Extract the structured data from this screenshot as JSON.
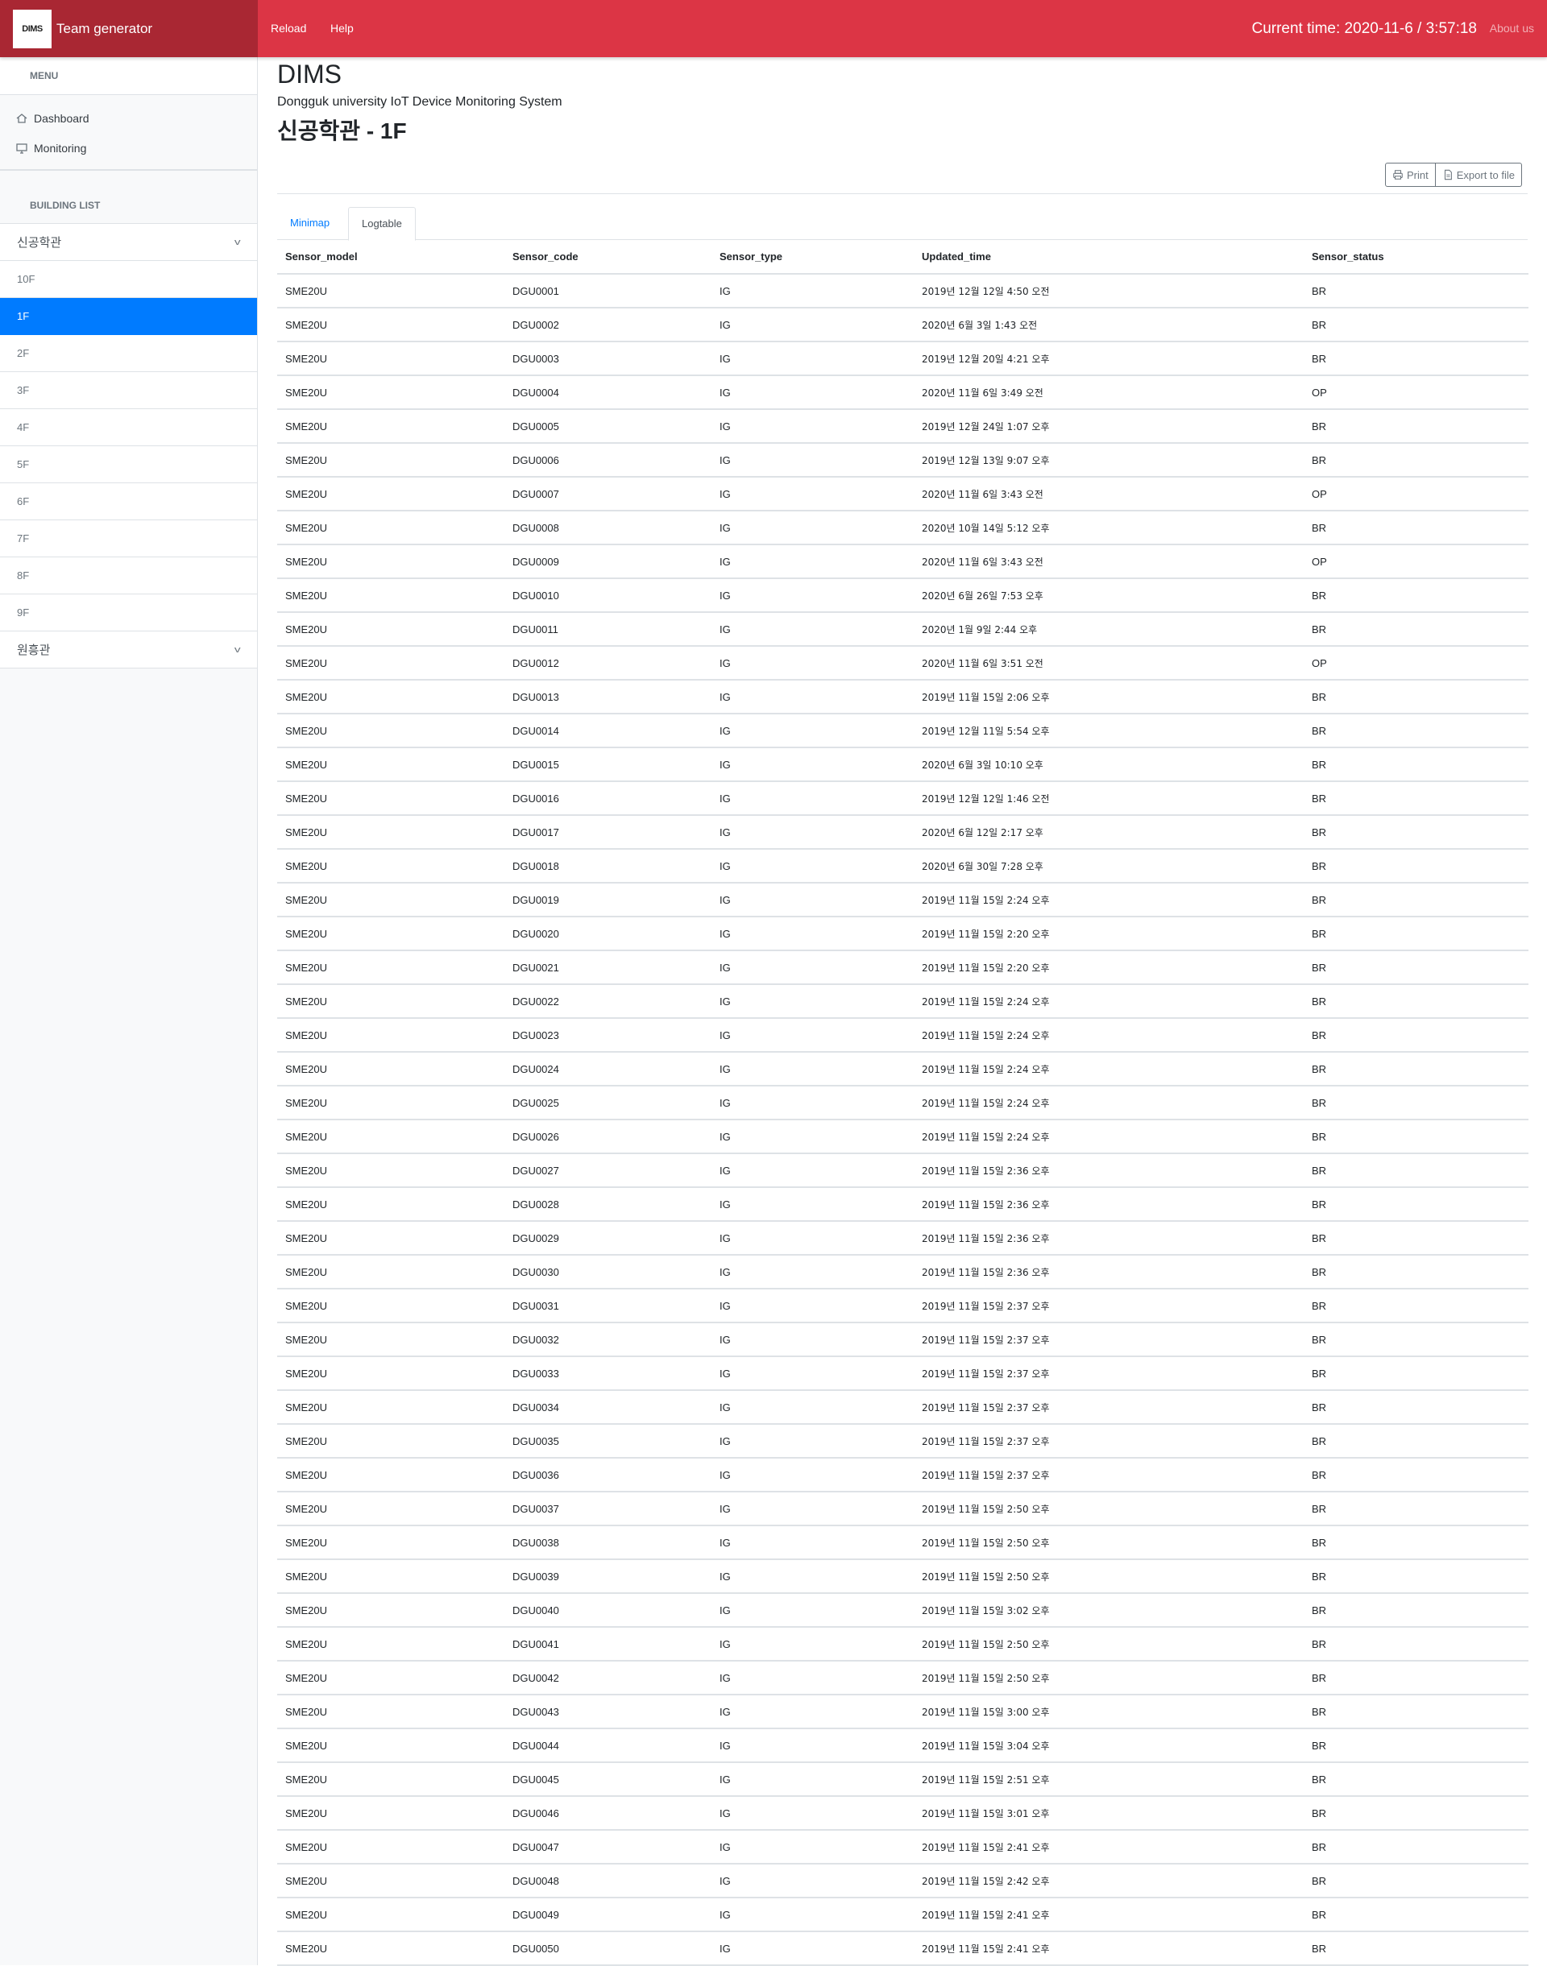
{
  "navbar": {
    "brand_logo": "DIMS",
    "brand_name": "Team generator",
    "links": [
      "Reload",
      "Help"
    ],
    "current_time": "Current time: 2020-11-6 / 3:57:18",
    "about": "About us",
    "color": "#dc3545",
    "brand_color": "#a92733"
  },
  "sidebar": {
    "menu_heading": "MENU",
    "menu_items": [
      {
        "label": "Dashboard",
        "icon": "home-icon"
      },
      {
        "label": "Monitoring",
        "icon": "monitor-icon"
      }
    ],
    "building_list_heading": "BUILDING LIST",
    "buildings": [
      {
        "name": "신공학관",
        "floors": [
          "10F",
          "1F",
          "2F",
          "3F",
          "4F",
          "5F",
          "6F",
          "7F",
          "8F",
          "9F"
        ],
        "active_floor": "1F"
      },
      {
        "name": "원흥관",
        "floors": []
      }
    ],
    "active_color": "#007bff"
  },
  "main": {
    "title": "DIMS",
    "subtitle": "Dongguk university IoT Device Monitoring System",
    "floor_title": "신공학관 - 1F",
    "buttons": {
      "print": "Print",
      "export": "Export to file"
    },
    "tabs": [
      {
        "label": "Minimap",
        "active": false
      },
      {
        "label": "Logtable",
        "active": true
      }
    ]
  },
  "table": {
    "columns": [
      "Sensor_model",
      "Sensor_code",
      "Sensor_type",
      "Updated_time",
      "Sensor_status"
    ],
    "rows": [
      [
        "SME20U",
        "DGU0001",
        "IG",
        "2019년 12월 12일 4:50 오전",
        "BR"
      ],
      [
        "SME20U",
        "DGU0002",
        "IG",
        "2020년 6월 3일 1:43 오전",
        "BR"
      ],
      [
        "SME20U",
        "DGU0003",
        "IG",
        "2019년 12월 20일 4:21 오후",
        "BR"
      ],
      [
        "SME20U",
        "DGU0004",
        "IG",
        "2020년 11월 6일 3:49 오전",
        "OP"
      ],
      [
        "SME20U",
        "DGU0005",
        "IG",
        "2019년 12월 24일 1:07 오후",
        "BR"
      ],
      [
        "SME20U",
        "DGU0006",
        "IG",
        "2019년 12월 13일 9:07 오후",
        "BR"
      ],
      [
        "SME20U",
        "DGU0007",
        "IG",
        "2020년 11월 6일 3:43 오전",
        "OP"
      ],
      [
        "SME20U",
        "DGU0008",
        "IG",
        "2020년 10월 14일 5:12 오후",
        "BR"
      ],
      [
        "SME20U",
        "DGU0009",
        "IG",
        "2020년 11월 6일 3:43 오전",
        "OP"
      ],
      [
        "SME20U",
        "DGU0010",
        "IG",
        "2020년 6월 26일 7:53 오후",
        "BR"
      ],
      [
        "SME20U",
        "DGU0011",
        "IG",
        "2020년 1월 9일 2:44 오후",
        "BR"
      ],
      [
        "SME20U",
        "DGU0012",
        "IG",
        "2020년 11월 6일 3:51 오전",
        "OP"
      ],
      [
        "SME20U",
        "DGU0013",
        "IG",
        "2019년 11월 15일 2:06 오후",
        "BR"
      ],
      [
        "SME20U",
        "DGU0014",
        "IG",
        "2019년 12월 11일 5:54 오후",
        "BR"
      ],
      [
        "SME20U",
        "DGU0015",
        "IG",
        "2020년 6월 3일 10:10 오후",
        "BR"
      ],
      [
        "SME20U",
        "DGU0016",
        "IG",
        "2019년 12월 12일 1:46 오전",
        "BR"
      ],
      [
        "SME20U",
        "DGU0017",
        "IG",
        "2020년 6월 12일 2:17 오후",
        "BR"
      ],
      [
        "SME20U",
        "DGU0018",
        "IG",
        "2020년 6월 30일 7:28 오후",
        "BR"
      ],
      [
        "SME20U",
        "DGU0019",
        "IG",
        "2019년 11월 15일 2:24 오후",
        "BR"
      ],
      [
        "SME20U",
        "DGU0020",
        "IG",
        "2019년 11월 15일 2:20 오후",
        "BR"
      ],
      [
        "SME20U",
        "DGU0021",
        "IG",
        "2019년 11월 15일 2:20 오후",
        "BR"
      ],
      [
        "SME20U",
        "DGU0022",
        "IG",
        "2019년 11월 15일 2:24 오후",
        "BR"
      ],
      [
        "SME20U",
        "DGU0023",
        "IG",
        "2019년 11월 15일 2:24 오후",
        "BR"
      ],
      [
        "SME20U",
        "DGU0024",
        "IG",
        "2019년 11월 15일 2:24 오후",
        "BR"
      ],
      [
        "SME20U",
        "DGU0025",
        "IG",
        "2019년 11월 15일 2:24 오후",
        "BR"
      ],
      [
        "SME20U",
        "DGU0026",
        "IG",
        "2019년 11월 15일 2:24 오후",
        "BR"
      ],
      [
        "SME20U",
        "DGU0027",
        "IG",
        "2019년 11월 15일 2:36 오후",
        "BR"
      ],
      [
        "SME20U",
        "DGU0028",
        "IG",
        "2019년 11월 15일 2:36 오후",
        "BR"
      ],
      [
        "SME20U",
        "DGU0029",
        "IG",
        "2019년 11월 15일 2:36 오후",
        "BR"
      ],
      [
        "SME20U",
        "DGU0030",
        "IG",
        "2019년 11월 15일 2:36 오후",
        "BR"
      ],
      [
        "SME20U",
        "DGU0031",
        "IG",
        "2019년 11월 15일 2:37 오후",
        "BR"
      ],
      [
        "SME20U",
        "DGU0032",
        "IG",
        "2019년 11월 15일 2:37 오후",
        "BR"
      ],
      [
        "SME20U",
        "DGU0033",
        "IG",
        "2019년 11월 15일 2:37 오후",
        "BR"
      ],
      [
        "SME20U",
        "DGU0034",
        "IG",
        "2019년 11월 15일 2:37 오후",
        "BR"
      ],
      [
        "SME20U",
        "DGU0035",
        "IG",
        "2019년 11월 15일 2:37 오후",
        "BR"
      ],
      [
        "SME20U",
        "DGU0036",
        "IG",
        "2019년 11월 15일 2:37 오후",
        "BR"
      ],
      [
        "SME20U",
        "DGU0037",
        "IG",
        "2019년 11월 15일 2:50 오후",
        "BR"
      ],
      [
        "SME20U",
        "DGU0038",
        "IG",
        "2019년 11월 15일 2:50 오후",
        "BR"
      ],
      [
        "SME20U",
        "DGU0039",
        "IG",
        "2019년 11월 15일 2:50 오후",
        "BR"
      ],
      [
        "SME20U",
        "DGU0040",
        "IG",
        "2019년 11월 15일 3:02 오후",
        "BR"
      ],
      [
        "SME20U",
        "DGU0041",
        "IG",
        "2019년 11월 15일 2:50 오후",
        "BR"
      ],
      [
        "SME20U",
        "DGU0042",
        "IG",
        "2019년 11월 15일 2:50 오후",
        "BR"
      ],
      [
        "SME20U",
        "DGU0043",
        "IG",
        "2019년 11월 15일 3:00 오후",
        "BR"
      ],
      [
        "SME20U",
        "DGU0044",
        "IG",
        "2019년 11월 15일 3:04 오후",
        "BR"
      ],
      [
        "SME20U",
        "DGU0045",
        "IG",
        "2019년 11월 15일 2:51 오후",
        "BR"
      ],
      [
        "SME20U",
        "DGU0046",
        "IG",
        "2019년 11월 15일 3:01 오후",
        "BR"
      ],
      [
        "SME20U",
        "DGU0047",
        "IG",
        "2019년 11월 15일 2:41 오후",
        "BR"
      ],
      [
        "SME20U",
        "DGU0048",
        "IG",
        "2019년 11월 15일 2:42 오후",
        "BR"
      ],
      [
        "SME20U",
        "DGU0049",
        "IG",
        "2019년 11월 15일 2:41 오후",
        "BR"
      ],
      [
        "SME20U",
        "DGU0050",
        "IG",
        "2019년 11월 15일 2:41 오후",
        "BR"
      ]
    ]
  }
}
